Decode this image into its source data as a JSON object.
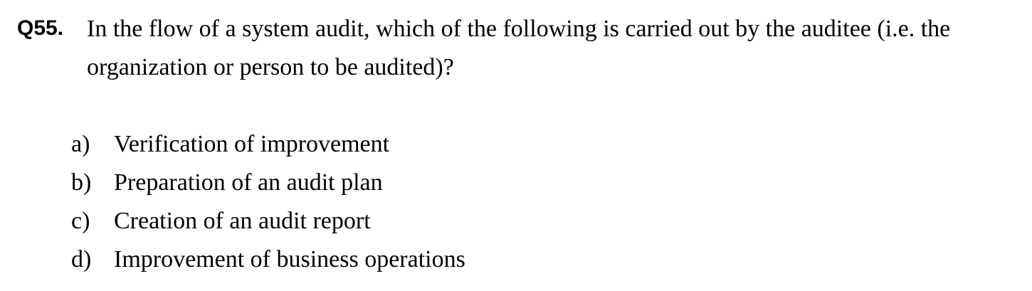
{
  "question": {
    "number": "Q55.",
    "text": "In the flow of a system audit, which of the following is carried out by the auditee (i.e. the organization or person to be audited)?"
  },
  "options": [
    {
      "letter": "a)",
      "text": "Verification of improvement"
    },
    {
      "letter": "b)",
      "text": "Preparation of an audit plan"
    },
    {
      "letter": "c)",
      "text": "Creation of an audit report"
    },
    {
      "letter": "d)",
      "text": "Improvement of business operations"
    }
  ]
}
